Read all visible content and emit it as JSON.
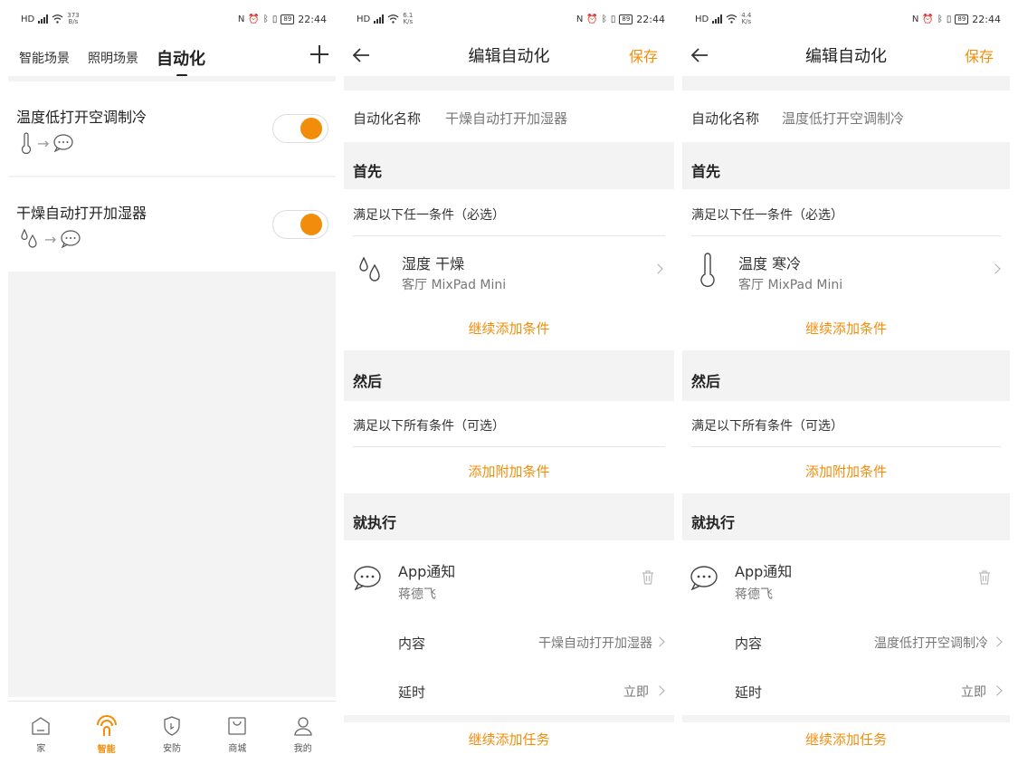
{
  "status_bar": {
    "s1_speed": "373\nB/s",
    "s2_speed": "6.1\nK/s",
    "s3_speed": "4.4\nK/s",
    "battery": "89",
    "time": "22:44"
  },
  "screen1": {
    "tabs": [
      "智能场景",
      "照明场景",
      "自动化"
    ],
    "automations": [
      {
        "name": "温度低打开空调制冷",
        "trigger_icon": "thermometer-icon",
        "action_icon": "message-icon",
        "enabled": true
      },
      {
        "name": "干燥自动打开加湿器",
        "trigger_icon": "water-drops-icon",
        "action_icon": "message-icon",
        "enabled": true
      }
    ],
    "nav": [
      {
        "label": "家",
        "icon": "home-icon"
      },
      {
        "label": "智能",
        "icon": "smart-icon",
        "active": true
      },
      {
        "label": "安防",
        "icon": "shield-icon"
      },
      {
        "label": "商城",
        "icon": "shop-icon"
      },
      {
        "label": "我的",
        "icon": "person-icon"
      }
    ]
  },
  "edit_common": {
    "title": "编辑自动化",
    "save": "保存",
    "name_label": "自动化名称",
    "first": "首先",
    "any_condition": "满足以下任一条件（必选）",
    "add_condition": "继续添加条件",
    "then": "然后",
    "all_condition": "满足以下所有条件（可选）",
    "add_extra_condition": "添加附加条件",
    "execute": "就执行",
    "task_title": "App通知",
    "task_user": "蒋德飞",
    "content_label": "内容",
    "delay_label": "延时",
    "delay_value": "立即",
    "add_task": "继续添加任务"
  },
  "screen2": {
    "automation_name": "干燥自动打开加湿器",
    "condition_title": "湿度 干燥",
    "condition_device": "客厅 MixPad Mini",
    "content_value": "干燥自动打开加湿器"
  },
  "screen3": {
    "automation_name": "温度低打开空调制冷",
    "condition_title": "温度 寒冷",
    "condition_device": "客厅 MixPad Mini",
    "content_value": "温度低打开空调制冷"
  },
  "colors": {
    "accent": "#f28d0b",
    "background": "#f3f3f3"
  }
}
